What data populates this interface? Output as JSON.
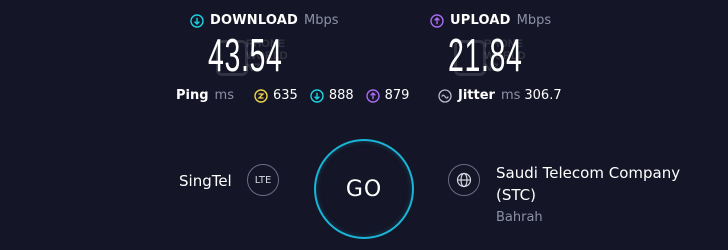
{
  "download": {
    "label": "DOWNLOAD",
    "unit": "Mbps",
    "value": "43.54",
    "color": "#1ad3e0"
  },
  "upload": {
    "label": "UPLOAD",
    "unit": "Mbps",
    "value": "21.84",
    "color": "#a86bf0"
  },
  "watermark": {
    "line1": "PHONE",
    "line2": "WORLD",
    "line3": "NZ"
  },
  "ping": {
    "label": "Ping",
    "unit": "ms",
    "idle": "635",
    "download": "888",
    "upload": "879"
  },
  "jitter": {
    "label": "Jitter",
    "unit": "ms",
    "value": "306.7"
  },
  "go_label": "GO",
  "carrier": {
    "name": "SingTel",
    "badge": "LTE"
  },
  "server": {
    "name_line1": "Saudi Telecom Company",
    "name_line2": "(STC)",
    "location": "Bahrah"
  },
  "colors": {
    "idle": "#f0d24a",
    "download": "#1ad3e0",
    "upload": "#a86bf0",
    "go_ring": "#1ab4d6"
  }
}
